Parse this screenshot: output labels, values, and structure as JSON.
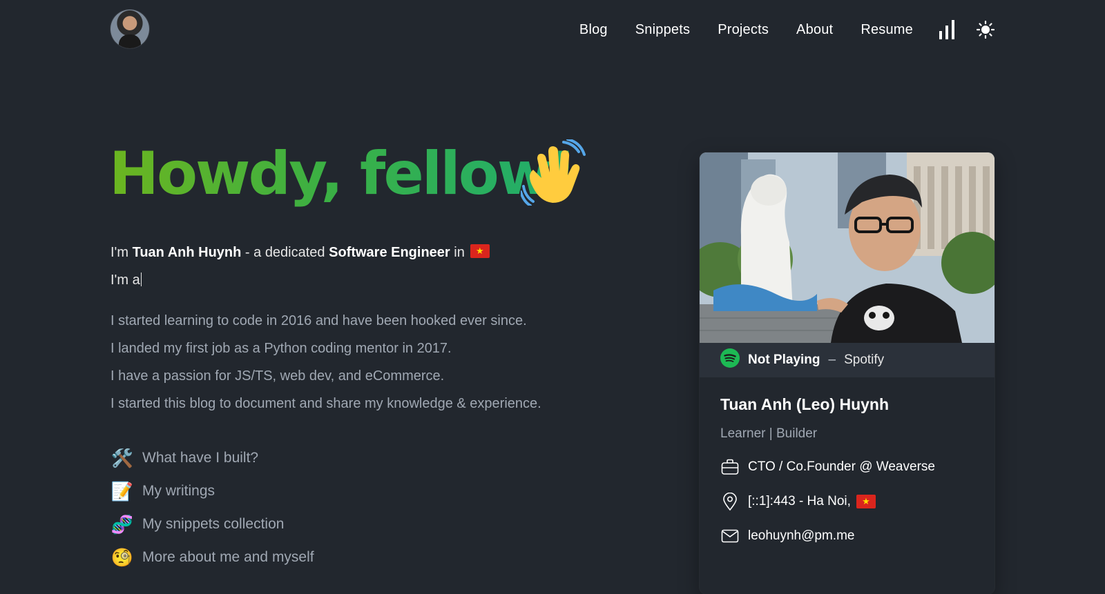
{
  "header": {
    "nav": [
      "Blog",
      "Snippets",
      "Projects",
      "About",
      "Resume"
    ]
  },
  "hero": {
    "title": "Howdy, fellow!",
    "intro_prefix": "I'm ",
    "intro_name": "Tuan Anh Huynh",
    "intro_mid": " - a dedicated ",
    "intro_role": "Software Engineer",
    "intro_suffix": " in",
    "typing_text": "I'm a",
    "story": [
      "I started learning to code in 2016 and have been hooked ever since.",
      "I landed my first job as a Python coding mentor in 2017.",
      "I have a passion for JS/TS, web dev, and eCommerce.",
      "I started this blog to document and share my knowledge & experience."
    ],
    "links": [
      {
        "emoji": "🛠️",
        "label": "What have I built?"
      },
      {
        "emoji": "📝",
        "label": "My writings"
      },
      {
        "emoji": "🧬",
        "label": "My snippets collection"
      },
      {
        "emoji": "🧐",
        "label": "More about me and myself"
      }
    ]
  },
  "card": {
    "spotify_status": "Not Playing",
    "spotify_dash": "–",
    "spotify_service": "Spotify",
    "name": "Tuan Anh (Leo) Huynh",
    "tagline": "Learner | Builder",
    "job": "CTO / Co.Founder @ Weaverse",
    "location": "[::1]:443 - Ha Noi,",
    "email": "leohuynh@pm.me"
  },
  "colors": {
    "background": "#22272e",
    "title_gradient_start": "#6cb520",
    "title_gradient_end": "#1fae6f",
    "spotify_green": "#1db954",
    "muted_text": "#a0a8b3"
  },
  "icons": {
    "analytics": "bar-chart-icon",
    "theme": "sun-icon",
    "wave": "waving-hand-icon",
    "job": "briefcase-icon",
    "location": "map-pin-icon",
    "email": "mail-icon",
    "spotify": "spotify-icon"
  }
}
